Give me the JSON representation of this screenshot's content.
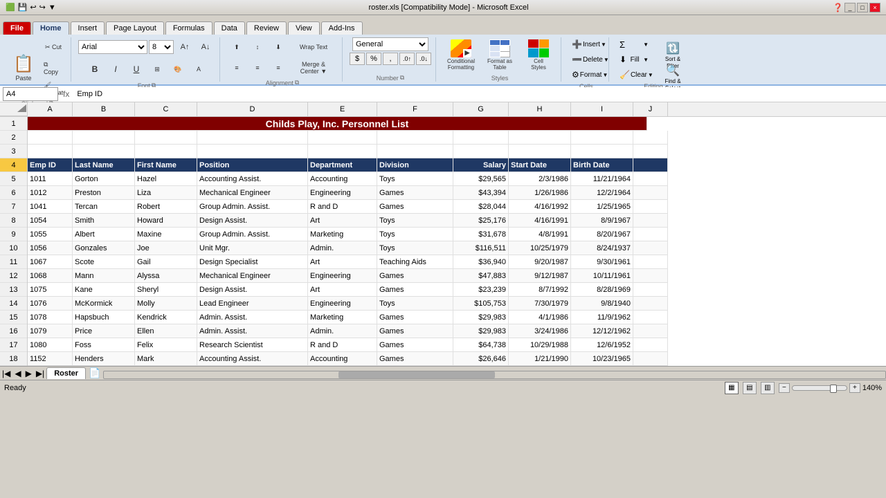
{
  "titleBar": {
    "title": "roster.xls [Compatibility Mode] - Microsoft Excel",
    "controls": [
      "_",
      "□",
      "×"
    ]
  },
  "quickAccess": {
    "buttons": [
      "💾",
      "↩",
      "↪"
    ]
  },
  "ribbonTabs": [
    "File",
    "Home",
    "Insert",
    "Page Layout",
    "Formulas",
    "Data",
    "Review",
    "View",
    "Add-Ins"
  ],
  "activeTab": "Home",
  "ribbon": {
    "clipboard": {
      "label": "Clipboard",
      "paste": "Paste",
      "cut": "✂",
      "copy": "⧉",
      "paintFormat": "🖌"
    },
    "font": {
      "label": "Font",
      "name": "Arial",
      "size": "8",
      "bold": "B",
      "italic": "I",
      "underline": "U",
      "borderBtn": "⊞",
      "fillBtn": "A",
      "colorBtn": "A"
    },
    "alignment": {
      "label": "Alignment",
      "wrapText": "Wrap Text",
      "mergeCenter": "Merge & Center",
      "buttons": [
        "≡",
        "≡",
        "≡",
        "⬆",
        "≡",
        "⬇",
        "⬅",
        "≡",
        "➡"
      ]
    },
    "number": {
      "label": "Number",
      "format": "General",
      "currency": "$",
      "percent": "%",
      "comma": ","
    },
    "styles": {
      "label": "Styles",
      "conditionalFormatting": "Conditional\nFormatting",
      "formatAsTable": "Format as\nTable",
      "cellStyles": "Cell\nStyles"
    },
    "cells": {
      "label": "Cells",
      "insert": "Insert",
      "delete": "Delete",
      "format": "Format"
    },
    "editing": {
      "label": "Editing",
      "autoSum": "Σ",
      "fill": "Fill",
      "clear": "Clear",
      "sortFilter": "Sort &\nFilter",
      "findSelect": "Find &\nSelect"
    }
  },
  "formulaBar": {
    "cellRef": "A4",
    "formula": "Emp ID"
  },
  "columnHeaders": [
    "A",
    "B",
    "C",
    "D",
    "E",
    "F",
    "G",
    "H",
    "I",
    "J"
  ],
  "rows": [
    {
      "num": 1,
      "cells": [
        "Childs Play, Inc. Personnel List",
        "",
        "",
        "",
        "",
        "",
        "",
        "",
        "",
        ""
      ]
    },
    {
      "num": 2,
      "cells": [
        "",
        "",
        "",
        "",
        "",
        "",
        "",
        "",
        "",
        ""
      ]
    },
    {
      "num": 3,
      "cells": [
        "",
        "",
        "",
        "",
        "",
        "",
        "",
        "",
        "",
        ""
      ]
    },
    {
      "num": 4,
      "cells": [
        "Emp ID",
        "Last Name",
        "First Name",
        "Position",
        "Department",
        "Division",
        "Salary",
        "Start Date",
        "Birth Date",
        ""
      ]
    },
    {
      "num": 5,
      "cells": [
        "1011",
        "Gorton",
        "Hazel",
        "Accounting Assist.",
        "Accounting",
        "Toys",
        "$29,565",
        "2/3/1986",
        "11/21/1964",
        ""
      ]
    },
    {
      "num": 6,
      "cells": [
        "1012",
        "Preston",
        "Liza",
        "Mechanical Engineer",
        "Engineering",
        "Games",
        "$43,394",
        "1/26/1986",
        "12/2/1964",
        ""
      ]
    },
    {
      "num": 7,
      "cells": [
        "1041",
        "Tercan",
        "Robert",
        "Group Admin. Assist.",
        "R and D",
        "Games",
        "$28,044",
        "4/16/1992",
        "1/25/1965",
        ""
      ]
    },
    {
      "num": 8,
      "cells": [
        "1054",
        "Smith",
        "Howard",
        "Design Assist.",
        "Art",
        "Toys",
        "$25,176",
        "4/16/1991",
        "8/9/1967",
        ""
      ]
    },
    {
      "num": 9,
      "cells": [
        "1055",
        "Albert",
        "Maxine",
        "Group Admin. Assist.",
        "Marketing",
        "Toys",
        "$31,678",
        "4/8/1991",
        "8/20/1967",
        ""
      ]
    },
    {
      "num": 10,
      "cells": [
        "1056",
        "Gonzales",
        "Joe",
        "Unit Mgr.",
        "Admin.",
        "Toys",
        "$116,511",
        "10/25/1979",
        "8/24/1937",
        ""
      ]
    },
    {
      "num": 11,
      "cells": [
        "1067",
        "Scote",
        "Gail",
        "Design Specialist",
        "Art",
        "Teaching Aids",
        "$36,940",
        "9/20/1987",
        "9/30/1961",
        ""
      ]
    },
    {
      "num": 12,
      "cells": [
        "1068",
        "Mann",
        "Alyssa",
        "Mechanical Engineer",
        "Engineering",
        "Games",
        "$47,883",
        "9/12/1987",
        "10/11/1961",
        ""
      ]
    },
    {
      "num": 13,
      "cells": [
        "1075",
        "Kane",
        "Sheryl",
        "Design Assist.",
        "Art",
        "Games",
        "$23,239",
        "8/7/1992",
        "8/28/1969",
        ""
      ]
    },
    {
      "num": 14,
      "cells": [
        "1076",
        "McKormick",
        "Molly",
        "Lead Engineer",
        "Engineering",
        "Toys",
        "$105,753",
        "7/30/1979",
        "9/8/1940",
        ""
      ]
    },
    {
      "num": 15,
      "cells": [
        "1078",
        "Hapsbuch",
        "Kendrick",
        "Admin. Assist.",
        "Marketing",
        "Games",
        "$29,983",
        "4/1/1986",
        "11/9/1962",
        ""
      ]
    },
    {
      "num": 16,
      "cells": [
        "1079",
        "Price",
        "Ellen",
        "Admin. Assist.",
        "Admin.",
        "Games",
        "$29,983",
        "3/24/1986",
        "12/12/1962",
        ""
      ]
    },
    {
      "num": 17,
      "cells": [
        "1080",
        "Foss",
        "Felix",
        "Research Scientist",
        "R and D",
        "Games",
        "$64,738",
        "10/29/1988",
        "12/6/1952",
        ""
      ]
    },
    {
      "num": 18,
      "cells": [
        "1152",
        "Henders",
        "Mark",
        "Accounting Assist.",
        "Accounting",
        "Games",
        "$26,646",
        "1/21/1990",
        "10/23/1965",
        ""
      ]
    }
  ],
  "sheetTabs": [
    "Roster"
  ],
  "activeSheet": "Roster",
  "statusBar": {
    "status": "Ready",
    "zoom": "140%"
  }
}
